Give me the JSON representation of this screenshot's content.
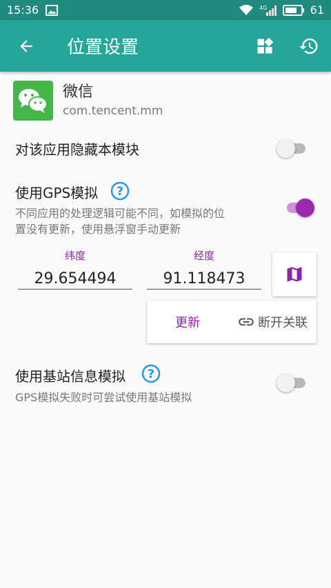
{
  "status": {
    "time": "15:36",
    "battery": "61"
  },
  "appbar": {
    "title": "位置设置",
    "icons": [
      "back-arrow-icon",
      "widgets-icon",
      "history-icon"
    ]
  },
  "app": {
    "name": "微信",
    "package": "com.tencent.mm",
    "icon": "wechat-icon"
  },
  "hide_module": {
    "label": "对该应用隐藏本模块",
    "enabled": false
  },
  "gps": {
    "label": "使用GPS模拟",
    "desc_line1": "不同应用的处理逻辑可能不同，如模拟的位",
    "desc_line2": "置没有更新，使用悬浮窗手动更新",
    "enabled": true,
    "latitude_label": "纬度",
    "latitude": "29.654494",
    "longitude_label": "经度",
    "longitude": "91.118473",
    "update_label": "更新",
    "disconnect_label": "断开关联"
  },
  "cell": {
    "label": "使用基站信息模拟",
    "desc": "GPS模拟失败时可尝试使用基站模拟",
    "enabled": false
  },
  "colors": {
    "appbar": "#26a69a",
    "statusbar": "#1f8a80",
    "accent": "#9c27b0",
    "help": "#2196f3"
  }
}
